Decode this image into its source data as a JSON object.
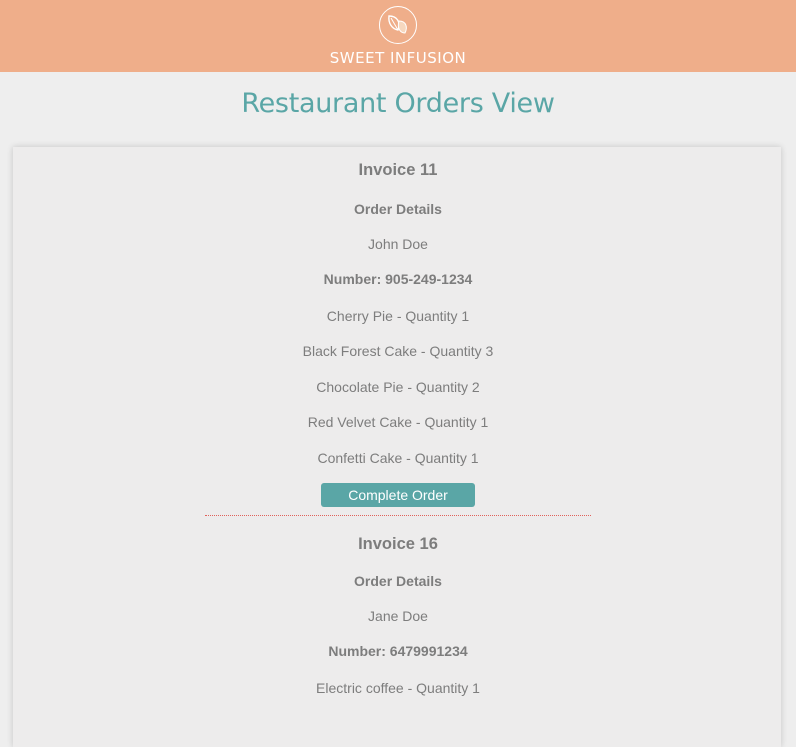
{
  "header": {
    "brand": "SWEET INFUSION",
    "logo_icon": "leaf-logo-icon"
  },
  "page_title": "Restaurant Orders View",
  "orders": [
    {
      "invoice": "Invoice 11",
      "details_label": "Order Details",
      "customer": "John Doe",
      "number": "Number: 905-249-1234",
      "items": [
        "Cherry Pie - Quantity 1",
        "Black Forest Cake - Quantity 3",
        "Chocolate Pie - Quantity 2",
        "Red Velvet Cake - Quantity 1",
        "Confetti Cake - Quantity 1"
      ],
      "button_label": "Complete Order"
    },
    {
      "invoice": "Invoice 16",
      "details_label": "Order Details",
      "customer": "Jane Doe",
      "number": "Number: 6479991234",
      "items": [
        "Electric coffee - Quantity 1"
      ]
    }
  ],
  "colors": {
    "header_bg": "#efae8a",
    "accent": "#5aa6a6",
    "divider": "#e0625c"
  }
}
